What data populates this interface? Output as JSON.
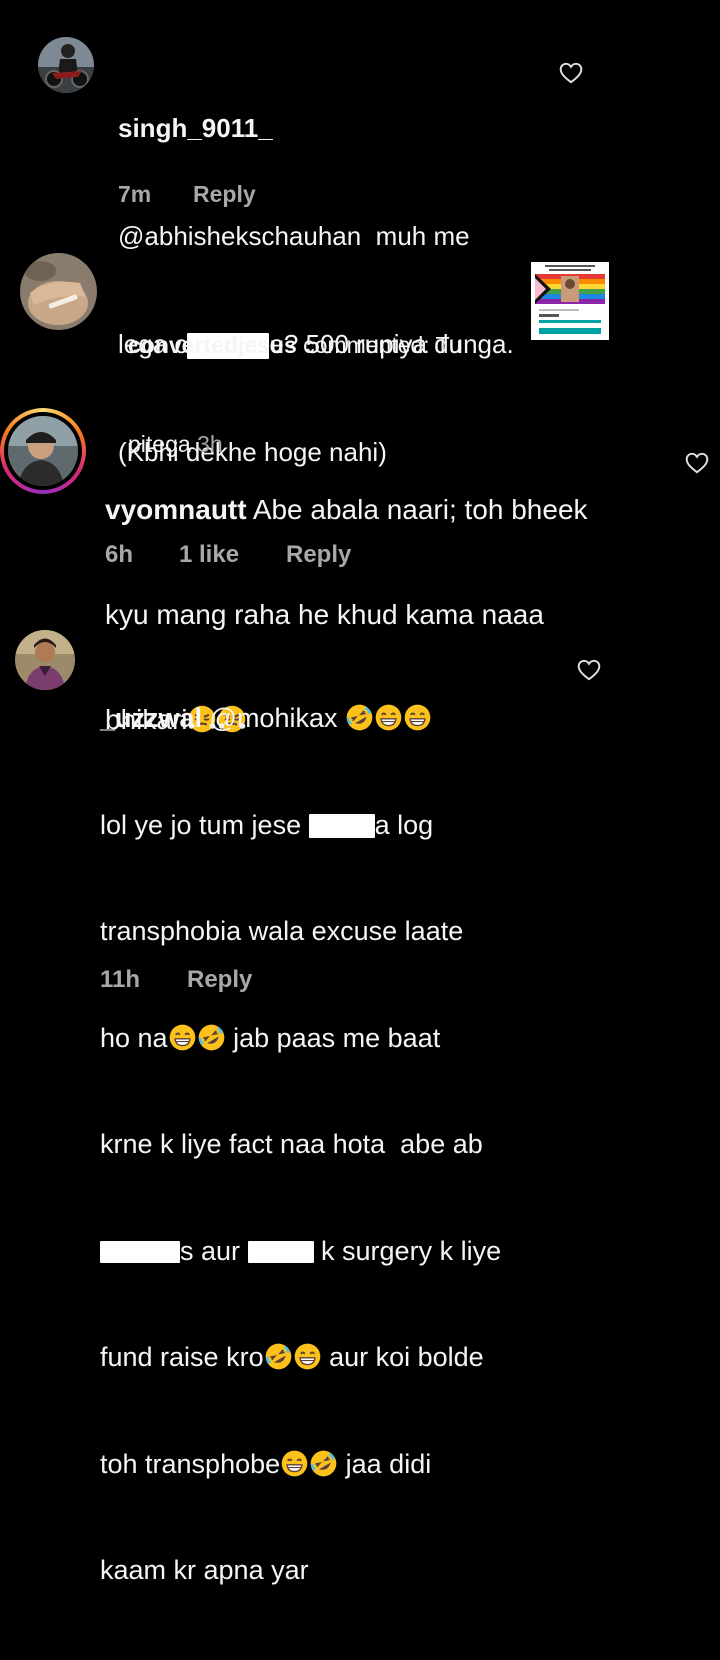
{
  "comments": [
    {
      "username": "singh_9011_",
      "lines": [
        [
          "@abhishekschauhan  muh me"
        ],
        [
          "lega c",
          "[R]",
          "e? 500 rupiya dunga."
        ],
        [
          "(Kbhi dekhe hoge nahi)"
        ]
      ],
      "time": "7m",
      "reply": "Reply",
      "avatar_icon": "motorcycle-rider-avatar"
    },
    {
      "username": "convertedjesus",
      "action": " commented: Tu",
      "line2": "pitega",
      "time": "3h",
      "avatar_icon": "hand-avatar",
      "thumbnail_icon": "fundraiser-thumbnail"
    },
    {
      "username": "vyomnautt",
      "line1": " Abe abala naari; toh bheek",
      "line2": "kyu mang raha he khud kama naaa",
      "line3": "bhikari",
      "time": "6h",
      "likes": "1 like",
      "reply": "Reply",
      "avatar_icon": "man-with-cap-avatar",
      "emoji_icon": "triumph-face-emoji"
    },
    {
      "username": "_uzzwal",
      "mention": " @mohikax",
      "l2a": "lol ye jo tum jese ",
      "l2b": "a log",
      "l3": "transphobia wala excuse laate",
      "l4a": "ho na",
      "l4b": " jab paas me baat",
      "l5": "krne k liye fact naa hota  abe ab",
      "l6a": "s aur ",
      "l6b": " k surgery k liye",
      "l7a": "fund raise kro",
      "l7b": " aur koi bolde",
      "l8a": "toh transphobe",
      "l8b": " jaa didi",
      "l9": "kaam kr apna yar",
      "time": "11h",
      "reply": "Reply",
      "avatar_icon": "young-man-avatar",
      "emoji_icons": [
        "rofl-emoji",
        "grinning-emoji"
      ]
    }
  ],
  "colors": {
    "background": "#000000",
    "text": "#f5f5f5",
    "meta": "#a8a8a8",
    "story_ring": "#d62976"
  }
}
